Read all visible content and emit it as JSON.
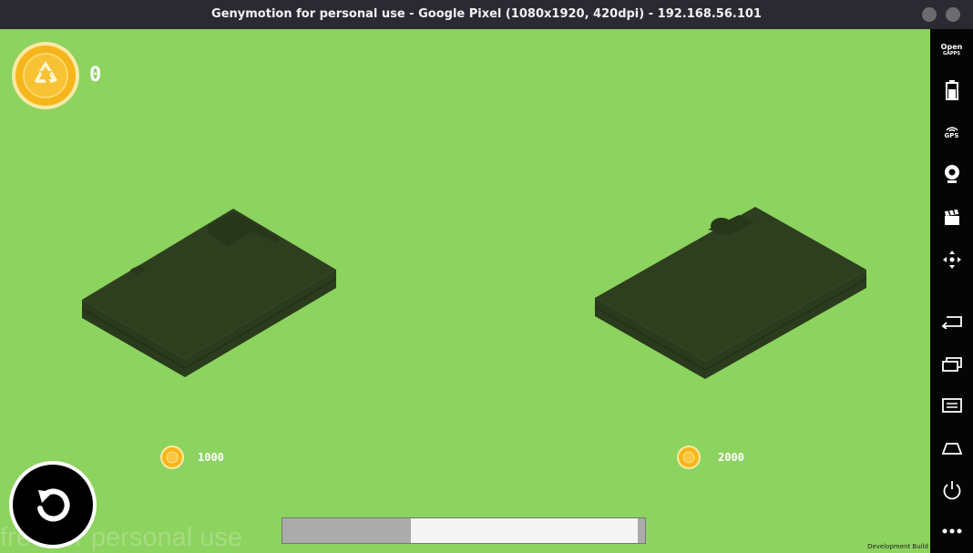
{
  "window": {
    "title": "Genymotion for personal use - Google Pixel (1080x1920, 420dpi) - 192.168.56.101"
  },
  "hud": {
    "coin_count": "0",
    "coin_icon": "recycle-coin-icon"
  },
  "shop": {
    "items": [
      {
        "price": "1000",
        "name": "flat-land-plot"
      },
      {
        "price": "2000",
        "name": "land-plot-with-bump"
      }
    ]
  },
  "watermark": "free for personal use",
  "dev_build": "Development Build",
  "progress": {
    "value": 0.35
  },
  "sidebar": {
    "opengapps_line1": "Open",
    "opengapps_line2": "GAPPS",
    "gps_label": "GPS",
    "icons": [
      "battery-icon",
      "gps-icon",
      "webcam-icon",
      "media-icon",
      "dpad-icon",
      "back-icon",
      "recent-apps-icon",
      "menu-icon",
      "home-icon",
      "power-icon",
      "more-icon"
    ]
  },
  "colors": {
    "background": "#8dd35f",
    "plot": "#2e3f1f",
    "coin": "#f6b51a"
  }
}
